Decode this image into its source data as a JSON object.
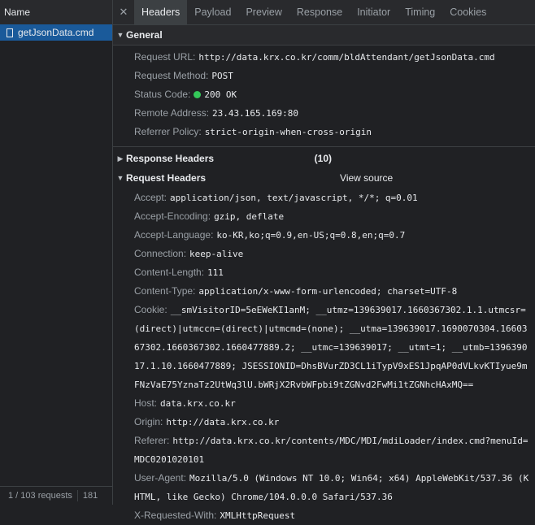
{
  "left": {
    "column_header": "Name",
    "request_name": "getJsonData.cmd",
    "footer_requests": "1 / 103 requests",
    "footer_size": "181"
  },
  "tabs": [
    "Headers",
    "Payload",
    "Preview",
    "Response",
    "Initiator",
    "Timing",
    "Cookies"
  ],
  "active_tab": "Headers",
  "general": {
    "title": "General",
    "rows": [
      {
        "k": "Request URL:",
        "v": "http://data.krx.co.kr/comm/bldAttendant/getJsonData.cmd"
      },
      {
        "k": "Request Method:",
        "v": "POST"
      },
      {
        "k": "Status Code:",
        "v": "200 OK"
      },
      {
        "k": "Remote Address:",
        "v": "23.43.165.169:80"
      },
      {
        "k": "Referrer Policy:",
        "v": "strict-origin-when-cross-origin"
      }
    ]
  },
  "response_headers": {
    "title": "Response Headers",
    "count": "(10)"
  },
  "request_headers": {
    "title": "Request Headers",
    "view_source": "View source",
    "rows": [
      {
        "k": "Accept:",
        "v": "application/json, text/javascript, */*; q=0.01"
      },
      {
        "k": "Accept-Encoding:",
        "v": "gzip, deflate"
      },
      {
        "k": "Accept-Language:",
        "v": "ko-KR,ko;q=0.9,en-US;q=0.8,en;q=0.7"
      },
      {
        "k": "Connection:",
        "v": "keep-alive"
      },
      {
        "k": "Content-Length:",
        "v": "111"
      },
      {
        "k": "Content-Type:",
        "v": "application/x-www-form-urlencoded; charset=UTF-8"
      },
      {
        "k": "Cookie:",
        "v": "__smVisitorID=5eEWeKI1anM; __utmz=139639017.1660367302.1.1.utmcsr=(direct)|utmccn=(direct)|utmcmd=(none); __utma=139639017.1690070304.1660367302.1660367302.1660477889.2; __utmc=139639017; __utmt=1; __utmb=139639017.1.10.1660477889; JSESSIONID=DhsBVurZD3CL1iTypV9xES1JpqAP0dVLkvKTIyue9mFNzVaE75YznaTz2UtWq3lU.bWRjX2RvbWFpbi9tZGNvd2FwMi1tZGNhcHAxMQ=="
      },
      {
        "k": "Host:",
        "v": "data.krx.co.kr"
      },
      {
        "k": "Origin:",
        "v": "http://data.krx.co.kr"
      },
      {
        "k": "Referer:",
        "v": "http://data.krx.co.kr/contents/MDC/MDI/mdiLoader/index.cmd?menuId=MDC0201020101"
      },
      {
        "k": "User-Agent:",
        "v": "Mozilla/5.0 (Windows NT 10.0; Win64; x64) AppleWebKit/537.36 (KHTML, like Gecko) Chrome/104.0.0.0 Safari/537.36"
      },
      {
        "k": "X-Requested-With:",
        "v": "XMLHttpRequest"
      }
    ]
  },
  "colors": {
    "selected_row": "#1a5a9a",
    "status_ok": "#34c759",
    "background": "#202124"
  }
}
